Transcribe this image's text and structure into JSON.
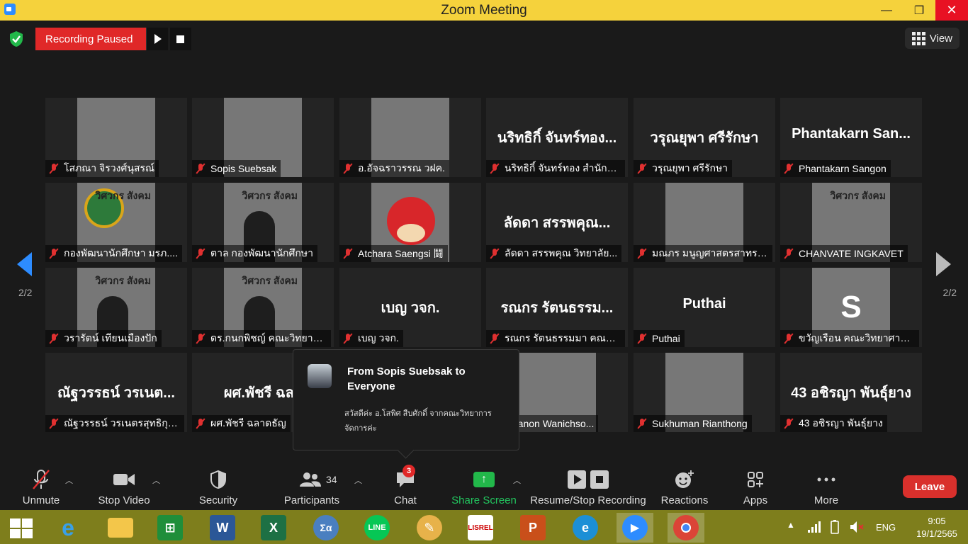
{
  "window": {
    "title": "Zoom Meeting",
    "minimize": "—",
    "maximize": "❐",
    "close": "✕"
  },
  "recording": {
    "status": "Recording Paused"
  },
  "view_button": {
    "label": "View"
  },
  "pagination": {
    "left": "2/2",
    "right": "2/2"
  },
  "tiles": [
    {
      "label": "โสภณา จิรวงศ์นุสรณ์",
      "big": "",
      "kind": "photo-a"
    },
    {
      "label": "Sopis Suebsak",
      "big": "",
      "kind": "photo-b"
    },
    {
      "label": "อ.อัจฉราวรรณ วฝค.",
      "big": "",
      "kind": "photo-c"
    },
    {
      "label": "นริทธิกิ์ จันทร์ทอง สำนักศิ...",
      "big": "นริทธิกิ์ จันทร์ทอง...",
      "kind": ""
    },
    {
      "label": "วรุณยุพา ศรีรักษา",
      "big": "วรุณยุพา ศรีรักษา",
      "kind": ""
    },
    {
      "label": "Phantakarn Sangon",
      "big": "Phantakarn San...",
      "kind": ""
    },
    {
      "label": "กองพัฒนานักศึกษา มรภ....",
      "big": "",
      "kind": "poster-emblem"
    },
    {
      "label": "ตาล กองพัฒนานักศึกษา",
      "big": "",
      "kind": "poster-person"
    },
    {
      "label": "Atchara Saengsi 鬪",
      "big": "",
      "kind": "bird"
    },
    {
      "label": "ลัดดา สรรพคุณ  วิทยาลัย...",
      "big": "ลัดดา สรรพคุณ...",
      "kind": ""
    },
    {
      "label": "มณภร มนูญศาสตรสาทร ...",
      "big": "",
      "kind": "photo-d"
    },
    {
      "label": "CHANVATE INGKAVET",
      "big": "",
      "kind": "poster-text"
    },
    {
      "label": "วรารัตน์ เทียนเมืองปัก",
      "big": "",
      "kind": "poster-person"
    },
    {
      "label": "ดร.กนกพิชญ์ คณะวิทยาก...",
      "big": "",
      "kind": "poster-person2"
    },
    {
      "label": "เบญ วจก.",
      "big": "เบญ วจก.",
      "kind": ""
    },
    {
      "label": "รณกร รัตนธรรมมา คณะวิ...",
      "big": "รณกร รัตนธรรม...",
      "kind": ""
    },
    {
      "label": "Puthai",
      "big": "Puthai",
      "kind": ""
    },
    {
      "label": "ขวัญเรือน คณะวิทยาศาสต...",
      "big": "",
      "kind": "purple",
      "letter": "S"
    },
    {
      "label": "ณัฐวรรธน์ วรเนตรสุทธิกุล ...",
      "big": "ณัฐวรรธน์ วรเนต...",
      "kind": ""
    },
    {
      "label": "ผศ.พัชรี  ฉลาดธัญ",
      "big": "ผศ.พัชรี  ฉลา",
      "kind": ""
    },
    {
      "label": "",
      "big": "",
      "kind": "hidden"
    },
    {
      "label": "tchanon Wanichso...",
      "big": "",
      "kind": "photo-e"
    },
    {
      "label": "Sukhuman Rianthong",
      "big": "",
      "kind": "photo-f"
    },
    {
      "label": "43 อชิรญา พันธุ์ยาง",
      "big": "43 อชิรญา พันธุ์ยาง",
      "kind": ""
    }
  ],
  "posters": {
    "org_title": "วิศวกร สังคม"
  },
  "chat_popup": {
    "from": "From Sopis Suebsak to Everyone",
    "message": "สวัสดีค่ะ อ.โสพิศ สืบศักดิ์ จากคณะวิทยาการจัดการค่ะ"
  },
  "toolbar": {
    "unmute": "Unmute",
    "stop_video": "Stop Video",
    "security": "Security",
    "participants": "Participants",
    "participants_count": "34",
    "chat": "Chat",
    "chat_badge": "3",
    "share_screen": "Share Screen",
    "resume_stop_recording": "Resume/Stop Recording",
    "reactions": "Reactions",
    "apps": "Apps",
    "more": "More",
    "leave": "Leave"
  },
  "taskbar": {
    "language": "ENG",
    "time": "9:05",
    "date": "19/1/2565",
    "apps": [
      "start-icon",
      "internet-explorer-icon",
      "file-explorer-icon",
      "store-icon",
      "word-icon",
      "excel-icon",
      "math-icon",
      "line-icon",
      "paint-icon",
      "lisrel-icon",
      "powerpoint-icon",
      "edge-icon",
      "zoom-icon",
      "chrome-icon"
    ]
  },
  "colors": {
    "accent": "#2d8cff",
    "recording": "#e02828",
    "leave": "#d9302c",
    "share": "#22b84a",
    "taskbar": "#7e7e1c",
    "titlebar": "#f5d23c"
  }
}
